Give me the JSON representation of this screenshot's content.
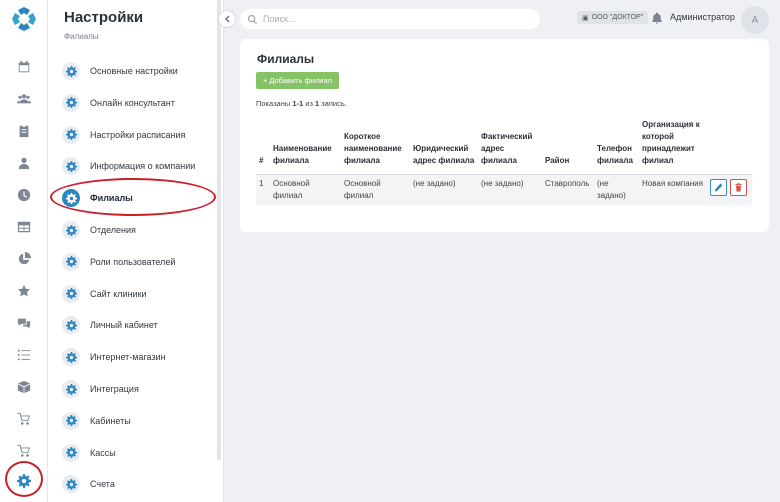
{
  "rail": {
    "icons": [
      "logo",
      "calendar-icon",
      "users-icon",
      "clipboard-icon",
      "doctor-icon",
      "clock-icon",
      "table-icon",
      "pie-chart-icon",
      "star-icon",
      "chat-icon",
      "checklist-icon",
      "boxes-icon",
      "cart-icon",
      "cart-plus-icon",
      "gear-icon"
    ]
  },
  "sidebar": {
    "title": "Настройки",
    "subtitle": "Филиалы",
    "items": [
      {
        "label": "Основные настройки"
      },
      {
        "label": "Онлайн консультант"
      },
      {
        "label": "Настройки расписания"
      },
      {
        "label": "Информация о компании"
      },
      {
        "label": "Филиалы",
        "active": true
      },
      {
        "label": "Отделения"
      },
      {
        "label": "Роли пользователей"
      },
      {
        "label": "Сайт клиники"
      },
      {
        "label": "Личный кабинет"
      },
      {
        "label": "Интернет-магазин"
      },
      {
        "label": "Интеграция"
      },
      {
        "label": "Кабинеты"
      },
      {
        "label": "Кассы"
      },
      {
        "label": "Счета"
      }
    ]
  },
  "topbar": {
    "search_placeholder": "Поиск...",
    "org": "ООО \"ДОКТОР\"",
    "user": "Администратор",
    "avatar_letter": "А"
  },
  "main": {
    "title": "Филиалы",
    "add_button": "Добавить филиал",
    "summary": {
      "prefix": "Показаны ",
      "range": "1-1",
      "mid": " из ",
      "total": "1",
      "suffix": " запись."
    },
    "columns": [
      "#",
      "Наименование филиала",
      "Короткое наименование филиала",
      "Юридический адрес филиала",
      "Фактический адрес филиала",
      "Район",
      "Телефон филиала",
      "Организация к которой принадлежит филиал"
    ],
    "rows": [
      {
        "num": "1",
        "name": "Основной филиал",
        "short": "Основной филиал",
        "legal": "(не задано)",
        "actual": "(не задано)",
        "district": "Ставрополь",
        "phone": "(не задано)",
        "org": "Новая компания"
      }
    ]
  },
  "colors": {
    "accent": "#2d86c0",
    "add_button": "#86c266",
    "highlight_ring": "#c8202c",
    "delete": "#d9534f"
  }
}
